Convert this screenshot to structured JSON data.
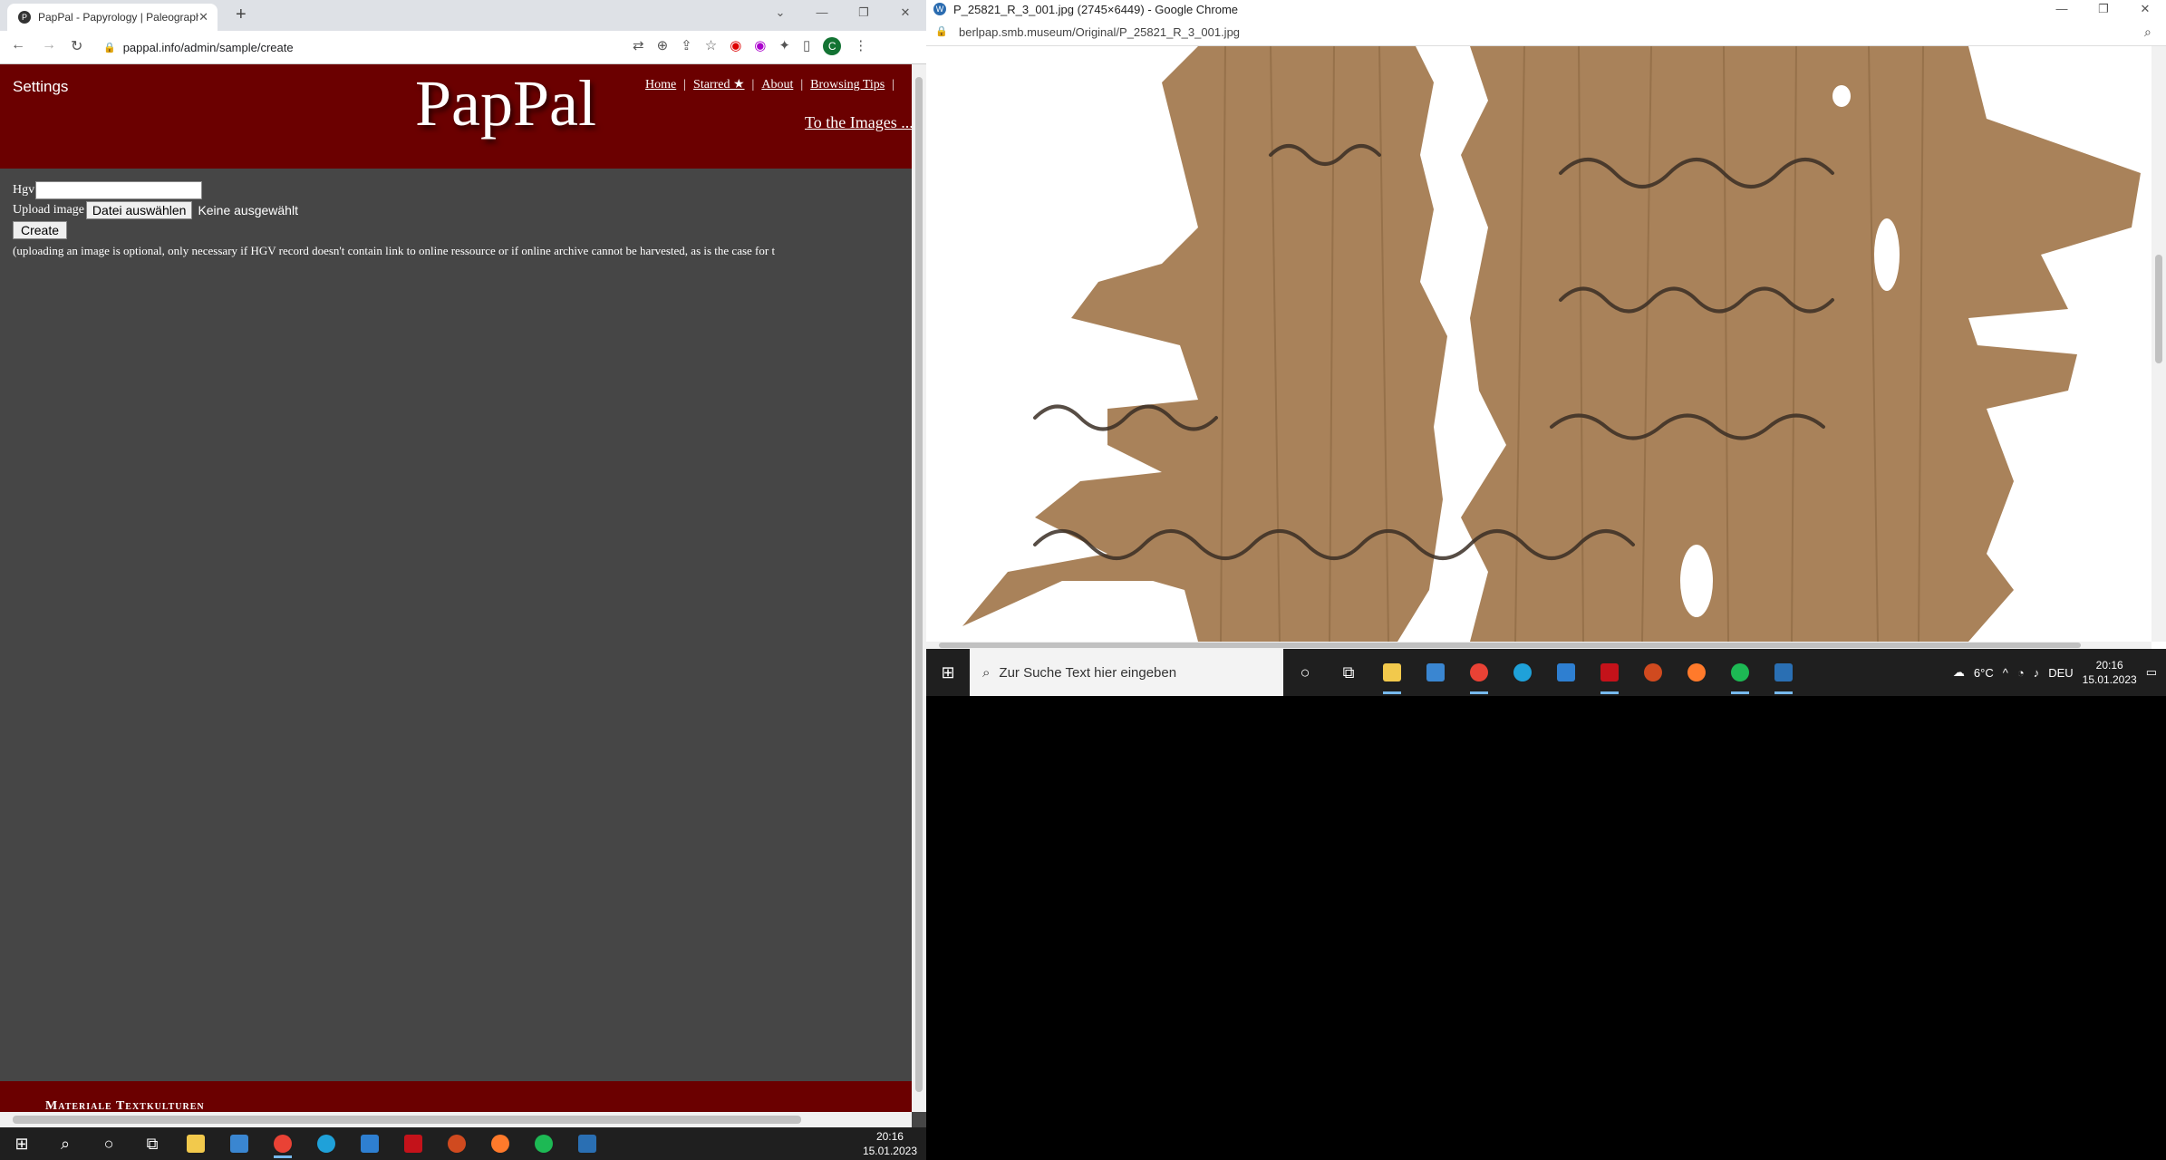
{
  "left_window": {
    "tab_title": "PapPal - Papyrology | Paleograph",
    "url": "pappal.info/admin/sample/create",
    "profile_initial": "C",
    "page": {
      "settings": "Settings",
      "logo": "PapPal",
      "nav": [
        "Home",
        "Starred ★",
        "About",
        "Browsing Tips"
      ],
      "to_images": "To the Images ...",
      "form": {
        "hgv_label": "Hgv",
        "upload_label": "Upload image",
        "file_button": "Datei auswählen",
        "no_file": "Keine ausgewählt",
        "create_button": "Create",
        "note": "(uploading an image is optional, only necessary if HGV record doesn't contain link to online ressource or if online archive cannot be harvested, as is the case for t"
      },
      "footer": "Materiale Textkulturen"
    }
  },
  "right_window": {
    "title": "P_25821_R_3_001.jpg (2745×6449) - Google Chrome",
    "url": "berlpap.smb.museum/Original/P_25821_R_3_001.jpg",
    "colors": {
      "papyrus": "#a9825a",
      "papyrus_dark": "#8a6640",
      "ink": "#3a2e25"
    }
  },
  "taskbar_right": {
    "search_placeholder": "Zur Suche Text hier eingeben",
    "weather": "6°C",
    "language": "DEU",
    "time": "20:16",
    "date": "15.01.2023"
  },
  "taskbar_left": {
    "time": "20:16",
    "date": "15.01.2023"
  }
}
